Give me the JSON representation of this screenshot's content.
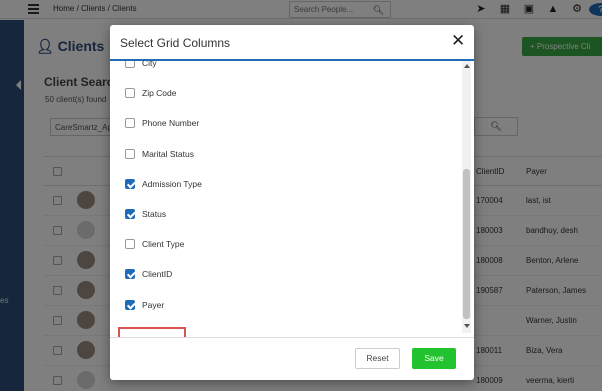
{
  "topbar": {
    "breadcrumb": "Home / Clients / Clients",
    "search_placeholder": "Search People...",
    "icons": [
      "menu-icon",
      "search-icon",
      "rocket-icon",
      "calendar-icon",
      "contact-card-icon",
      "bell-icon",
      "gear-icon",
      "help-icon"
    ],
    "help_glyph": "?"
  },
  "sidebar": {
    "partial_text": "es"
  },
  "background": {
    "page_title": "Clients",
    "prospective_button": "+ Prospective Cli",
    "client_search_title": "Client Search",
    "clients_found": "50 client(s) found",
    "filter_value": "CareSmartz_Ap",
    "table": {
      "headers": [
        "ClientID",
        "Payer"
      ],
      "rows": [
        {
          "client_id": "170004",
          "payer": "last, ist",
          "avatar": "photo"
        },
        {
          "client_id": "180003",
          "payer": "bandhuy, desh",
          "avatar": "placeholder"
        },
        {
          "client_id": "180008",
          "payer": "Benton, Arlene",
          "avatar": "photo"
        },
        {
          "client_id": "190587",
          "payer": "Paterson, James",
          "avatar": "photo"
        },
        {
          "client_id": "",
          "payer": "Warner, Justin",
          "avatar": "photo"
        },
        {
          "client_id": "180011",
          "payer": "Biza, Vera",
          "avatar": "photo"
        },
        {
          "client_id": "180009",
          "payer": "veerma, kierti",
          "avatar": "placeholder"
        }
      ]
    }
  },
  "modal": {
    "title": "Select Grid Columns",
    "close_glyph": "✕",
    "options": [
      {
        "label": "City",
        "checked": false
      },
      {
        "label": "Zip Code",
        "checked": false
      },
      {
        "label": "Phone Number",
        "checked": false
      },
      {
        "label": "Marital Status",
        "checked": false
      },
      {
        "label": "Admission Type",
        "checked": true
      },
      {
        "label": "Status",
        "checked": true
      },
      {
        "label": "Client Type",
        "checked": false
      },
      {
        "label": "ClientID",
        "checked": true
      },
      {
        "label": "Payer",
        "checked": true
      }
    ],
    "highlighted_option": "Payer",
    "highlight_color": "#d9534f",
    "reset_label": "Reset",
    "save_label": "Save"
  },
  "colors": {
    "accent": "#1e6bb8",
    "save_green": "#22c32e",
    "sidebar": "#2d4d7a"
  }
}
